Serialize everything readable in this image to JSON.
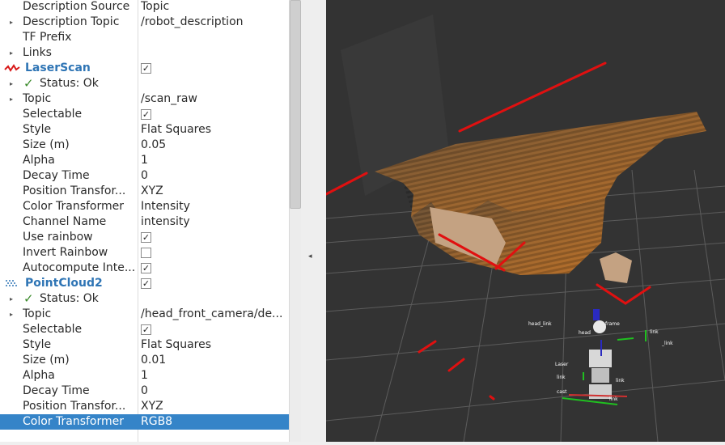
{
  "properties": [
    {
      "name": "Description Source",
      "value": "Topic"
    },
    {
      "name": "Description Topic",
      "value": "/robot_description",
      "expand": "▸"
    },
    {
      "name": "TF Prefix",
      "value": ""
    },
    {
      "name": "Links",
      "value": "",
      "expand": "▸"
    },
    {
      "name": "LaserScan",
      "value": "",
      "display": "laser",
      "checked": "✓"
    },
    {
      "name": "Status: Ok",
      "value": "",
      "expand": "▸",
      "status": "✓"
    },
    {
      "name": "Topic",
      "value": "/scan_raw",
      "expand": "▸"
    },
    {
      "name": "Selectable",
      "value": "",
      "checked": "✓"
    },
    {
      "name": "Style",
      "value": "Flat Squares"
    },
    {
      "name": "Size (m)",
      "value": "0.05"
    },
    {
      "name": "Alpha",
      "value": "1"
    },
    {
      "name": "Decay Time",
      "value": "0"
    },
    {
      "name": "Position Transfor...",
      "value": "XYZ"
    },
    {
      "name": "Color Transformer",
      "value": "Intensity"
    },
    {
      "name": "Channel Name",
      "value": "intensity"
    },
    {
      "name": "Use rainbow",
      "value": "",
      "checked": "✓"
    },
    {
      "name": "Invert Rainbow",
      "value": "",
      "checked": ""
    },
    {
      "name": "Autocompute Inte...",
      "value": "",
      "checked": "✓"
    },
    {
      "name": "PointCloud2",
      "value": "",
      "display": "cloud",
      "checked": "✓"
    },
    {
      "name": "Status: Ok",
      "value": "",
      "expand": "▸",
      "status": "✓"
    },
    {
      "name": "Topic",
      "value": "/head_front_camera/de...",
      "expand": "▸"
    },
    {
      "name": "Selectable",
      "value": "",
      "checked": "✓"
    },
    {
      "name": "Style",
      "value": "Flat Squares"
    },
    {
      "name": "Size (m)",
      "value": "0.01"
    },
    {
      "name": "Alpha",
      "value": "1"
    },
    {
      "name": "Decay Time",
      "value": "0"
    },
    {
      "name": "Position Transfor...",
      "value": "XYZ"
    },
    {
      "name": "Color Transformer",
      "value": "RGB8",
      "selected": true
    }
  ],
  "splitter": {
    "arrow": "◂"
  },
  "colors": {
    "selection": "#3584c8",
    "display_label": "#2f75b5",
    "viewport_bg": "#333333",
    "laser": "#e01010"
  }
}
